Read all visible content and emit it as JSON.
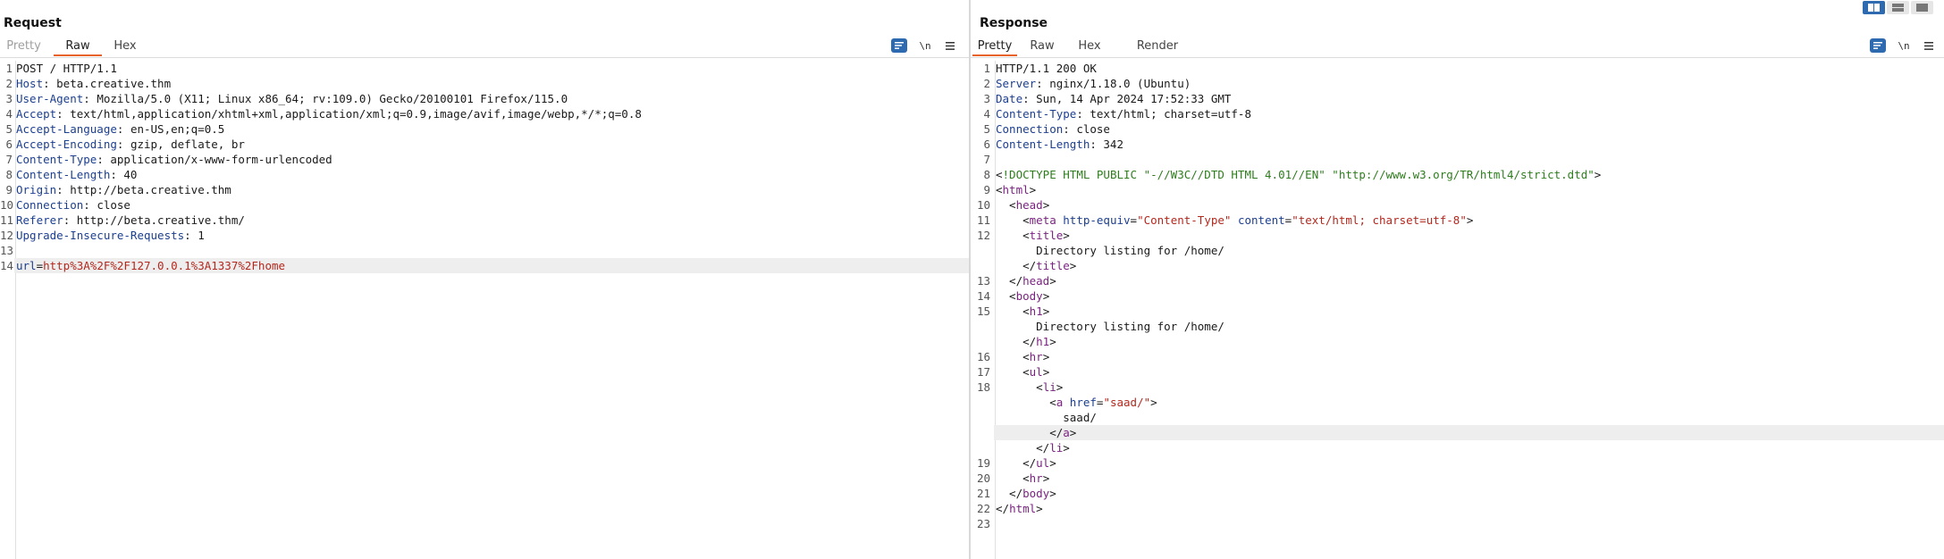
{
  "request": {
    "title": "Request",
    "tabs": [
      {
        "label": "Pretty",
        "state": "disabled"
      },
      {
        "label": "Raw",
        "state": "active"
      },
      {
        "label": "Hex",
        "state": "normal"
      }
    ],
    "toolbar": {
      "wrap_icon": "wrap-lines-icon",
      "newline_label": "\\n",
      "menu_icon": "menu-icon"
    },
    "lines": [
      {
        "n": "1",
        "parts": [
          [
            "",
            "POST / HTTP/1.1"
          ]
        ]
      },
      {
        "n": "2",
        "parts": [
          [
            "hk",
            "Host"
          ],
          [
            "",
            ": beta.creative.thm"
          ]
        ]
      },
      {
        "n": "3",
        "parts": [
          [
            "hk",
            "User-Agent"
          ],
          [
            "",
            ": Mozilla/5.0 (X11; Linux x86_64; rv:109.0) Gecko/20100101 Firefox/115.0"
          ]
        ]
      },
      {
        "n": "4",
        "parts": [
          [
            "hk",
            "Accept"
          ],
          [
            "",
            ": text/html,application/xhtml+xml,application/xml;q=0.9,image/avif,image/webp,*/*;q=0.8"
          ]
        ]
      },
      {
        "n": "5",
        "parts": [
          [
            "hk",
            "Accept-Language"
          ],
          [
            "",
            ": en-US,en;q=0.5"
          ]
        ]
      },
      {
        "n": "6",
        "parts": [
          [
            "hk",
            "Accept-Encoding"
          ],
          [
            "",
            ": gzip, deflate, br"
          ]
        ]
      },
      {
        "n": "7",
        "parts": [
          [
            "hk",
            "Content-Type"
          ],
          [
            "",
            ": application/x-www-form-urlencoded"
          ]
        ]
      },
      {
        "n": "8",
        "parts": [
          [
            "hk",
            "Content-Length"
          ],
          [
            "",
            ": 40"
          ]
        ]
      },
      {
        "n": "9",
        "parts": [
          [
            "hk",
            "Origin"
          ],
          [
            "",
            ": http://beta.creative.thm"
          ]
        ]
      },
      {
        "n": "10",
        "parts": [
          [
            "hk",
            "Connection"
          ],
          [
            "",
            ": close"
          ]
        ]
      },
      {
        "n": "11",
        "parts": [
          [
            "hk",
            "Referer"
          ],
          [
            "",
            ": http://beta.creative.thm/"
          ]
        ]
      },
      {
        "n": "12",
        "parts": [
          [
            "hk",
            "Upgrade-Insecure-Requests"
          ],
          [
            "",
            ": 1"
          ]
        ]
      },
      {
        "n": "13",
        "parts": []
      },
      {
        "n": "14",
        "parts": [
          [
            "pk",
            "url"
          ],
          [
            "",
            "="
          ],
          [
            "pv",
            "http%3A%2F%2F127.0.0.1%3A1337%2Fhome"
          ]
        ],
        "highlight": true
      }
    ]
  },
  "response": {
    "title": "Response",
    "tabs": [
      {
        "label": "Pretty",
        "state": "active"
      },
      {
        "label": "Raw",
        "state": "normal"
      },
      {
        "label": "Hex",
        "state": "normal"
      },
      {
        "label": "Render",
        "state": "normal"
      }
    ],
    "toolbar": {
      "wrap_icon": "wrap-lines-icon",
      "newline_label": "\\n",
      "menu_icon": "menu-icon"
    },
    "lines": [
      {
        "n": "1",
        "parts": [
          [
            "",
            "HTTP/1.1 200 OK"
          ]
        ]
      },
      {
        "n": "2",
        "parts": [
          [
            "hk",
            "Server"
          ],
          [
            "",
            ": nginx/1.18.0 (Ubuntu)"
          ]
        ]
      },
      {
        "n": "3",
        "parts": [
          [
            "hk",
            "Date"
          ],
          [
            "",
            ": Sun, 14 Apr 2024 17:52:33 GMT"
          ]
        ]
      },
      {
        "n": "4",
        "parts": [
          [
            "hk",
            "Content-Type"
          ],
          [
            "",
            ": text/html; charset=utf-8"
          ]
        ]
      },
      {
        "n": "5",
        "parts": [
          [
            "hk",
            "Connection"
          ],
          [
            "",
            ": close"
          ]
        ]
      },
      {
        "n": "6",
        "parts": [
          [
            "hk",
            "Content-Length"
          ],
          [
            "",
            ": 342"
          ]
        ]
      },
      {
        "n": "7",
        "parts": []
      },
      {
        "n": "8",
        "parts": [
          [
            "",
            "<"
          ],
          [
            "dt",
            "!DOCTYPE HTML PUBLIC \"-//W3C//DTD HTML 4.01//EN\" \"http://www.w3.org/TR/html4/strict.dtd\""
          ],
          [
            "",
            ">"
          ]
        ]
      },
      {
        "n": "9",
        "parts": [
          [
            "",
            "<"
          ],
          [
            "tg",
            "html"
          ],
          [
            "",
            ">"
          ]
        ]
      },
      {
        "n": "10",
        "parts": [
          [
            "",
            "  <"
          ],
          [
            "tg",
            "head"
          ],
          [
            "",
            ">"
          ]
        ]
      },
      {
        "n": "11",
        "parts": [
          [
            "",
            "    <"
          ],
          [
            "tg",
            "meta"
          ],
          [
            "",
            " "
          ],
          [
            "at",
            "http-equiv"
          ],
          [
            "",
            "="
          ],
          [
            "av",
            "\"Content-Type\""
          ],
          [
            "",
            " "
          ],
          [
            "at",
            "content"
          ],
          [
            "",
            "="
          ],
          [
            "av",
            "\"text/html; charset=utf-8\""
          ],
          [
            "",
            ">"
          ]
        ]
      },
      {
        "n": "12",
        "parts": [
          [
            "",
            "    <"
          ],
          [
            "tg",
            "title"
          ],
          [
            "",
            ">"
          ]
        ]
      },
      {
        "n": "",
        "parts": [
          [
            "",
            "      Directory listing for /home/"
          ]
        ]
      },
      {
        "n": "",
        "parts": [
          [
            "",
            "    </"
          ],
          [
            "tg",
            "title"
          ],
          [
            "",
            ">"
          ]
        ]
      },
      {
        "n": "13",
        "parts": [
          [
            "",
            "  </"
          ],
          [
            "tg",
            "head"
          ],
          [
            "",
            ">"
          ]
        ]
      },
      {
        "n": "14",
        "parts": [
          [
            "",
            "  <"
          ],
          [
            "tg",
            "body"
          ],
          [
            "",
            ">"
          ]
        ]
      },
      {
        "n": "15",
        "parts": [
          [
            "",
            "    <"
          ],
          [
            "tg",
            "h1"
          ],
          [
            "",
            ">"
          ]
        ]
      },
      {
        "n": "",
        "parts": [
          [
            "",
            "      Directory listing for /home/"
          ]
        ]
      },
      {
        "n": "",
        "parts": [
          [
            "",
            "    </"
          ],
          [
            "tg",
            "h1"
          ],
          [
            "",
            ">"
          ]
        ]
      },
      {
        "n": "16",
        "parts": [
          [
            "",
            "    <"
          ],
          [
            "tg",
            "hr"
          ],
          [
            "",
            ">"
          ]
        ]
      },
      {
        "n": "17",
        "parts": [
          [
            "",
            "    <"
          ],
          [
            "tg",
            "ul"
          ],
          [
            "",
            ">"
          ]
        ]
      },
      {
        "n": "18",
        "parts": [
          [
            "",
            "      <"
          ],
          [
            "tg",
            "li"
          ],
          [
            "",
            ">"
          ]
        ]
      },
      {
        "n": "",
        "parts": [
          [
            "",
            "        <"
          ],
          [
            "tg",
            "a"
          ],
          [
            "",
            " "
          ],
          [
            "at",
            "href"
          ],
          [
            "",
            "="
          ],
          [
            "av",
            "\"saad/\""
          ],
          [
            "",
            ">"
          ]
        ]
      },
      {
        "n": "",
        "parts": [
          [
            "",
            "          saad/"
          ]
        ]
      },
      {
        "n": "",
        "parts": [
          [
            "",
            "        </"
          ],
          [
            "tg",
            "a"
          ],
          [
            "",
            ">"
          ]
        ],
        "highlight": true
      },
      {
        "n": "",
        "parts": [
          [
            "",
            "      </"
          ],
          [
            "tg",
            "li"
          ],
          [
            "",
            ">"
          ]
        ]
      },
      {
        "n": "19",
        "parts": [
          [
            "",
            "    </"
          ],
          [
            "tg",
            "ul"
          ],
          [
            "",
            ">"
          ]
        ]
      },
      {
        "n": "20",
        "parts": [
          [
            "",
            "    <"
          ],
          [
            "tg",
            "hr"
          ],
          [
            "",
            ">"
          ]
        ]
      },
      {
        "n": "21",
        "parts": [
          [
            "",
            "  </"
          ],
          [
            "tg",
            "body"
          ],
          [
            "",
            ">"
          ]
        ]
      },
      {
        "n": "22",
        "parts": [
          [
            "",
            "</"
          ],
          [
            "tg",
            "html"
          ],
          [
            "",
            ">"
          ]
        ]
      },
      {
        "n": "23",
        "parts": []
      }
    ]
  },
  "layout_buttons": [
    {
      "name": "layout-side-by-side-button",
      "active": true
    },
    {
      "name": "layout-stacked-button",
      "active": false
    },
    {
      "name": "layout-tabs-button",
      "active": false
    }
  ],
  "colors": {
    "accent": "#e8622c",
    "button_blue": "#2e6ab0"
  }
}
